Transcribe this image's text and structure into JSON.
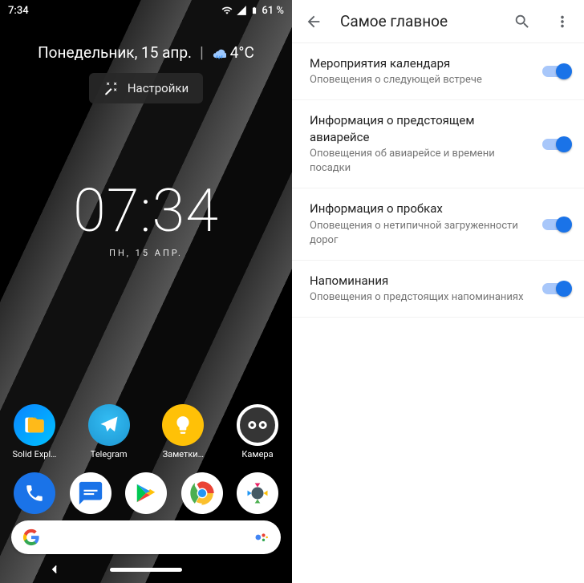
{
  "statusbar": {
    "time": "7:34",
    "battery": "61 %"
  },
  "glance": {
    "date": "Понедельник, 15 апр.",
    "temp": "4°C",
    "chip_label": "Настройки"
  },
  "clock": {
    "time": "07:34",
    "date": "ПН, 15 АПР."
  },
  "apps": [
    {
      "name": "solid-explorer",
      "label": "Solid Expl…"
    },
    {
      "name": "telegram",
      "label": "Telegram"
    },
    {
      "name": "notes",
      "label": "Заметки…"
    },
    {
      "name": "camera",
      "label": "Камера"
    }
  ],
  "dock": [
    {
      "name": "phone"
    },
    {
      "name": "messages"
    },
    {
      "name": "play-store"
    },
    {
      "name": "chrome"
    },
    {
      "name": "camera2"
    }
  ],
  "settings": {
    "title": "Самое главное",
    "items": [
      {
        "title": "Мероприятия календаря",
        "subtitle": "Оповещения о следующей встрече"
      },
      {
        "title": "Информация о предстоящем авиарейсе",
        "subtitle": "Оповещения об авиарейсе и времени посадки"
      },
      {
        "title": "Информация о пробках",
        "subtitle": "Оповещения о нетипичной загруженности дорог"
      },
      {
        "title": "Напоминания",
        "subtitle": "Оповещения о предстоящих напоминаниях"
      }
    ]
  }
}
